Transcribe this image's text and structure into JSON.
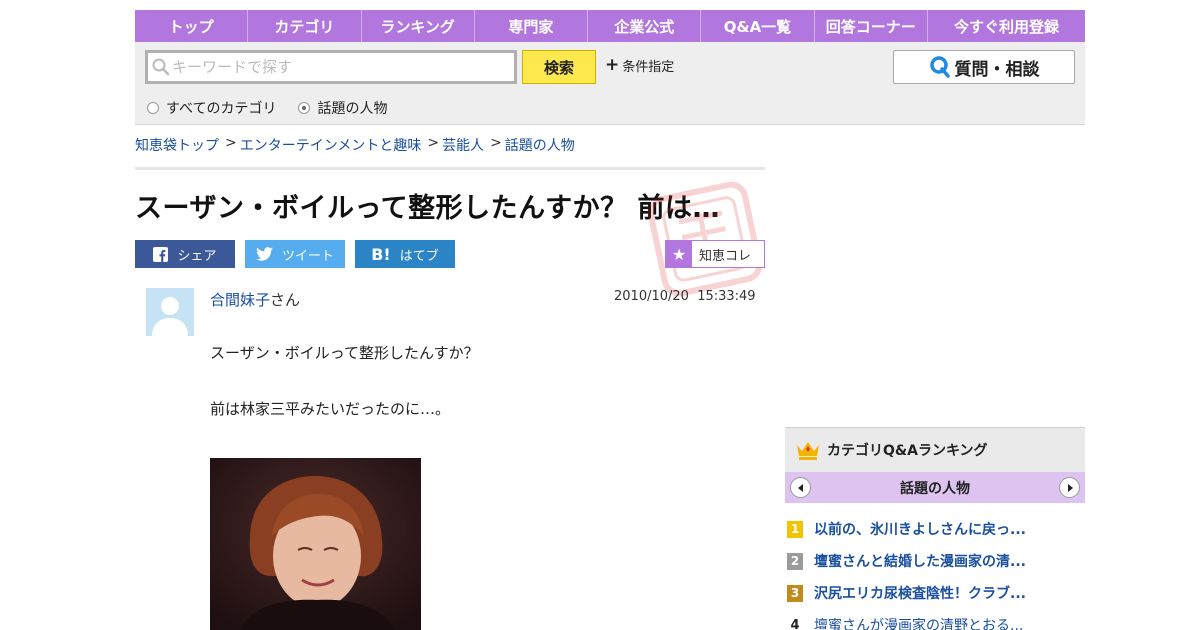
{
  "nav": {
    "items": [
      "トップ",
      "カテゴリ",
      "ランキング",
      "専門家",
      "企業公式",
      "Q&A一覧",
      "回答コーナー",
      "今すぐ利用登録"
    ]
  },
  "search": {
    "placeholder": "キーワードで探す",
    "button_label": "検索",
    "condition_label": "条件指定",
    "radio_all": "すべてのカテゴリ",
    "radio_topic": "話題の人物",
    "selected": "話題の人物",
    "ask_label": "質問・相談"
  },
  "breadcrumb": {
    "items": [
      "知恵袋トップ",
      "エンターテインメントと趣味",
      "芸能人",
      "話題の人物"
    ],
    "separator": ">"
  },
  "question": {
    "title": "スーザン・ボイルって整形したんすか？ 前は…",
    "user_name": "合間妹子",
    "user_suffix": "さん",
    "date": "2010/10/20  15:33:49",
    "line1": "スーザン・ボイルって整形したんすか？",
    "line2": "前は林家三平みたいだったのに…。"
  },
  "share": {
    "facebook": "シェア",
    "twitter": "ツイート",
    "hatena": "はてブ",
    "hatena_mark": "B!",
    "collection": "知恵コレ"
  },
  "ranking": {
    "title": "カテゴリQ&Aランキング",
    "category": "話題の人物",
    "items": [
      {
        "rank": "1",
        "text": "以前の、氷川きよしさんに戻っ..."
      },
      {
        "rank": "2",
        "text": "壇蜜さんと結婚した漫画家の清..."
      },
      {
        "rank": "3",
        "text": "沢尻エリカ尿検査陰性！クラブ..."
      },
      {
        "rank": "4",
        "text": "壇蜜さんが漫画家の清野とおる..."
      }
    ]
  },
  "colors": {
    "nav_purple": "#b277de",
    "tab_lavender": "#dcc3f0",
    "search_yellow": "#fde94e",
    "link_blue": "#1a4fa0",
    "facebook": "#3b5998",
    "twitter": "#55acee",
    "hatena": "#2b84c6",
    "rank_gold": "#f2c400",
    "rank_silver": "#9a9a9a",
    "rank_bronze": "#c08a1c"
  },
  "icons": [
    "search-icon",
    "plus-icon",
    "q-icon",
    "stamp-icon",
    "facebook-icon",
    "twitter-icon",
    "hatena-icon",
    "star-icon",
    "avatar-icon",
    "crown-icon",
    "chevron-left-icon",
    "chevron-right-icon"
  ]
}
